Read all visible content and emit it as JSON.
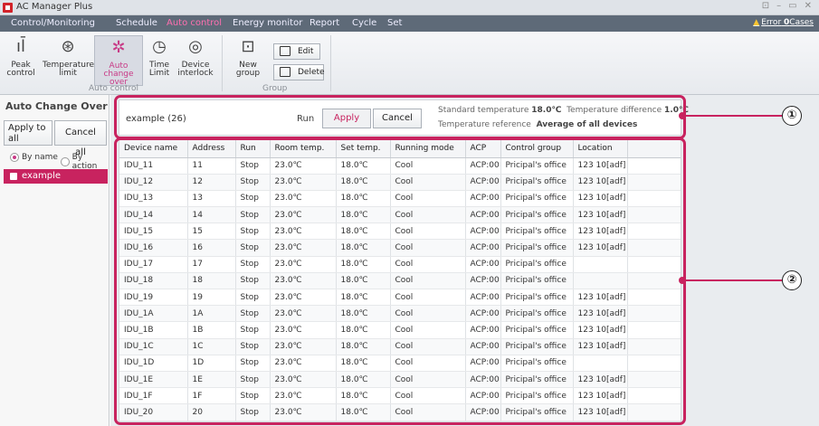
{
  "window": {
    "title": "AC Manager Plus",
    "controls": [
      "⊡",
      "–",
      "▭",
      "✕"
    ]
  },
  "menu": {
    "items": [
      {
        "label": "Control/Monitoring",
        "active": false
      },
      {
        "label": "Schedule",
        "active": false
      },
      {
        "label": "Auto control",
        "active": true
      },
      {
        "label": "Energy monitor",
        "active": false
      },
      {
        "label": "Report",
        "active": false
      },
      {
        "label": "Cycle",
        "active": false
      },
      {
        "label": "Set",
        "active": false
      }
    ],
    "error_prefix": "Error",
    "error_count": "0",
    "error_suffix": "Cases"
  },
  "ribbon": {
    "auto_control": {
      "group_label": "Auto control",
      "buttons": [
        {
          "line1": "Peak",
          "line2": "control",
          "icon": "peak-control-icon"
        },
        {
          "line1": "Temperature",
          "line2": "limit",
          "icon": "thermometer-icon"
        },
        {
          "line1": "Auto",
          "line2": "change over",
          "icon": "auto-change-over-icon"
        },
        {
          "line1": "Time",
          "line2": "Limit",
          "icon": "clock-icon"
        },
        {
          "line1": "Device",
          "line2": "interlock",
          "icon": "interlock-icon"
        }
      ]
    },
    "group": {
      "group_label": "Group",
      "new_group": "New group",
      "edit": "Edit",
      "delete": "Delete"
    }
  },
  "sidebar": {
    "title": "Auto Change Over",
    "apply_all_line1": "Apply to",
    "apply_all_line2": "all",
    "cancel_all": "Cancel all",
    "radio_by_name": "By name",
    "radio_by_action": "By action",
    "selected_radio": "By name",
    "tree_item": "example"
  },
  "infobar": {
    "group_name": "example (26)",
    "run_label": "Run",
    "apply": "Apply",
    "cancel": "Cancel",
    "std_temp_label": "Standard temperature",
    "std_temp_value": "18.0℃",
    "temp_diff_label": "Temperature difference",
    "temp_diff_value": "1.0℃",
    "temp_ref_label": "Temperature reference",
    "temp_ref_value": "Average of all devices"
  },
  "table": {
    "columns": [
      "Device name",
      "Address",
      "Run",
      "Room temp.",
      "Set temp.",
      "Running mode",
      "ACP",
      "Control group",
      "Location",
      ""
    ],
    "rows": [
      [
        "IDU_11",
        "11",
        "Stop",
        "23.0℃",
        "18.0℃",
        "Cool",
        "ACP:00",
        "Pricipal's office",
        "123  10[adf]",
        ""
      ],
      [
        "IDU_12",
        "12",
        "Stop",
        "23.0℃",
        "18.0℃",
        "Cool",
        "ACP:00",
        "Pricipal's office",
        "123  10[adf]",
        ""
      ],
      [
        "IDU_13",
        "13",
        "Stop",
        "23.0℃",
        "18.0℃",
        "Cool",
        "ACP:00",
        "Pricipal's office",
        "123  10[adf]",
        ""
      ],
      [
        "IDU_14",
        "14",
        "Stop",
        "23.0℃",
        "18.0℃",
        "Cool",
        "ACP:00",
        "Pricipal's office",
        "123  10[adf]",
        ""
      ],
      [
        "IDU_15",
        "15",
        "Stop",
        "23.0℃",
        "18.0℃",
        "Cool",
        "ACP:00",
        "Pricipal's office",
        "123  10[adf]",
        ""
      ],
      [
        "IDU_16",
        "16",
        "Stop",
        "23.0℃",
        "18.0℃",
        "Cool",
        "ACP:00",
        "Pricipal's office",
        "123  10[adf]",
        ""
      ],
      [
        "IDU_17",
        "17",
        "Stop",
        "23.0℃",
        "18.0℃",
        "Cool",
        "ACP:00",
        "Pricipal's office",
        "",
        ""
      ],
      [
        "IDU_18",
        "18",
        "Stop",
        "23.0℃",
        "18.0℃",
        "Cool",
        "ACP:00",
        "Pricipal's office",
        "",
        ""
      ],
      [
        "IDU_19",
        "19",
        "Stop",
        "23.0℃",
        "18.0℃",
        "Cool",
        "ACP:00",
        "Pricipal's office",
        "123  10[adf]",
        ""
      ],
      [
        "IDU_1A",
        "1A",
        "Stop",
        "23.0℃",
        "18.0℃",
        "Cool",
        "ACP:00",
        "Pricipal's office",
        "123  10[adf]",
        ""
      ],
      [
        "IDU_1B",
        "1B",
        "Stop",
        "23.0℃",
        "18.0℃",
        "Cool",
        "ACP:00",
        "Pricipal's office",
        "123  10[adf]",
        ""
      ],
      [
        "IDU_1C",
        "1C",
        "Stop",
        "23.0℃",
        "18.0℃",
        "Cool",
        "ACP:00",
        "Pricipal's office",
        "123  10[adf]",
        ""
      ],
      [
        "IDU_1D",
        "1D",
        "Stop",
        "23.0℃",
        "18.0℃",
        "Cool",
        "ACP:00",
        "Pricipal's office",
        "",
        ""
      ],
      [
        "IDU_1E",
        "1E",
        "Stop",
        "23.0℃",
        "18.0℃",
        "Cool",
        "ACP:00",
        "Pricipal's office",
        "123  10[adf]",
        ""
      ],
      [
        "IDU_1F",
        "1F",
        "Stop",
        "23.0℃",
        "18.0℃",
        "Cool",
        "ACP:00",
        "Pricipal's office",
        "123  10[adf]",
        ""
      ],
      [
        "IDU_20",
        "20",
        "Stop",
        "23.0℃",
        "18.0℃",
        "Cool",
        "ACP:00",
        "Pricipal's office",
        "123  10[adf]",
        ""
      ]
    ]
  },
  "callouts": [
    "①",
    "②"
  ],
  "colors": {
    "accent": "#c8235f",
    "menubar": "#5e6a78",
    "active_menu": "#ff6fb0"
  }
}
